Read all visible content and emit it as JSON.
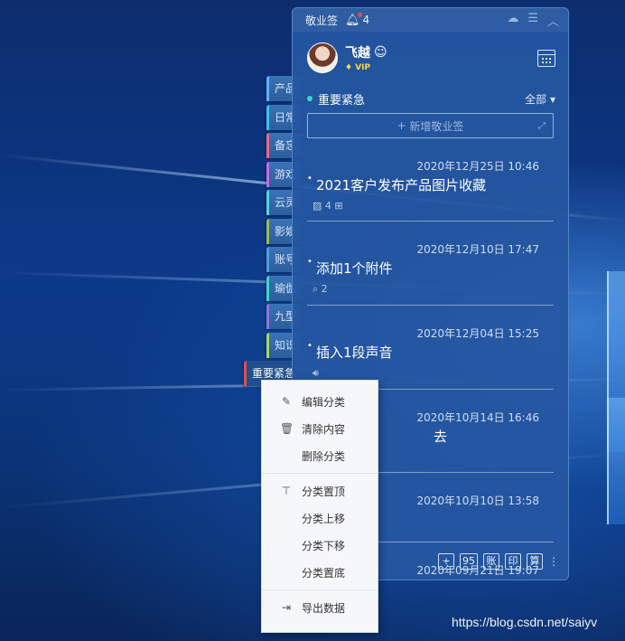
{
  "app": {
    "title": "敬业签",
    "notification_count": "4"
  },
  "user": {
    "name": "飞越",
    "badge": "VIP"
  },
  "category": {
    "name": "重要紧急",
    "filter": "全部"
  },
  "add_button": {
    "label": "新增敬业签"
  },
  "side_tabs": [
    "产品",
    "日常",
    "备忘",
    "游戏",
    "云灵",
    "影娱",
    "账号",
    "瑜伽",
    "九型",
    "知识",
    "重要紧急"
  ],
  "notes": [
    {
      "time": "2020年12月25日 10:46",
      "title": "2021客户发布产品图片收藏",
      "meta": "4"
    },
    {
      "time": "2020年12月10日 17:47",
      "title": "添加1个附件",
      "meta": "2"
    },
    {
      "time": "2020年12月04日 15:25",
      "title": "插入1段声音",
      "meta": ""
    },
    {
      "time": "2020年10月14日 16:46",
      "title": "去",
      "meta": ""
    },
    {
      "time": "2020年10月10日 13:58",
      "title": "",
      "meta": ""
    },
    {
      "time": "2020年09月21日 19:07",
      "title": "",
      "meta": ""
    }
  ],
  "footer_buttons": [
    "+",
    "95",
    "账",
    "印",
    "算"
  ],
  "context_menu": {
    "edit": "编辑分类",
    "clear": "清除内容",
    "delete": "删除分类",
    "pin_top": "分类置顶",
    "move_up": "分类上移",
    "move_down": "分类下移",
    "move_bottom": "分类置底",
    "export": "导出数据"
  },
  "watermark": "https://blog.csdn.net/saiyv",
  "colors": {
    "panel_bg": "#2556a0",
    "accent_dot": "#3fd7c6",
    "alert": "#e84a4a",
    "vip": "#ffd94a"
  }
}
